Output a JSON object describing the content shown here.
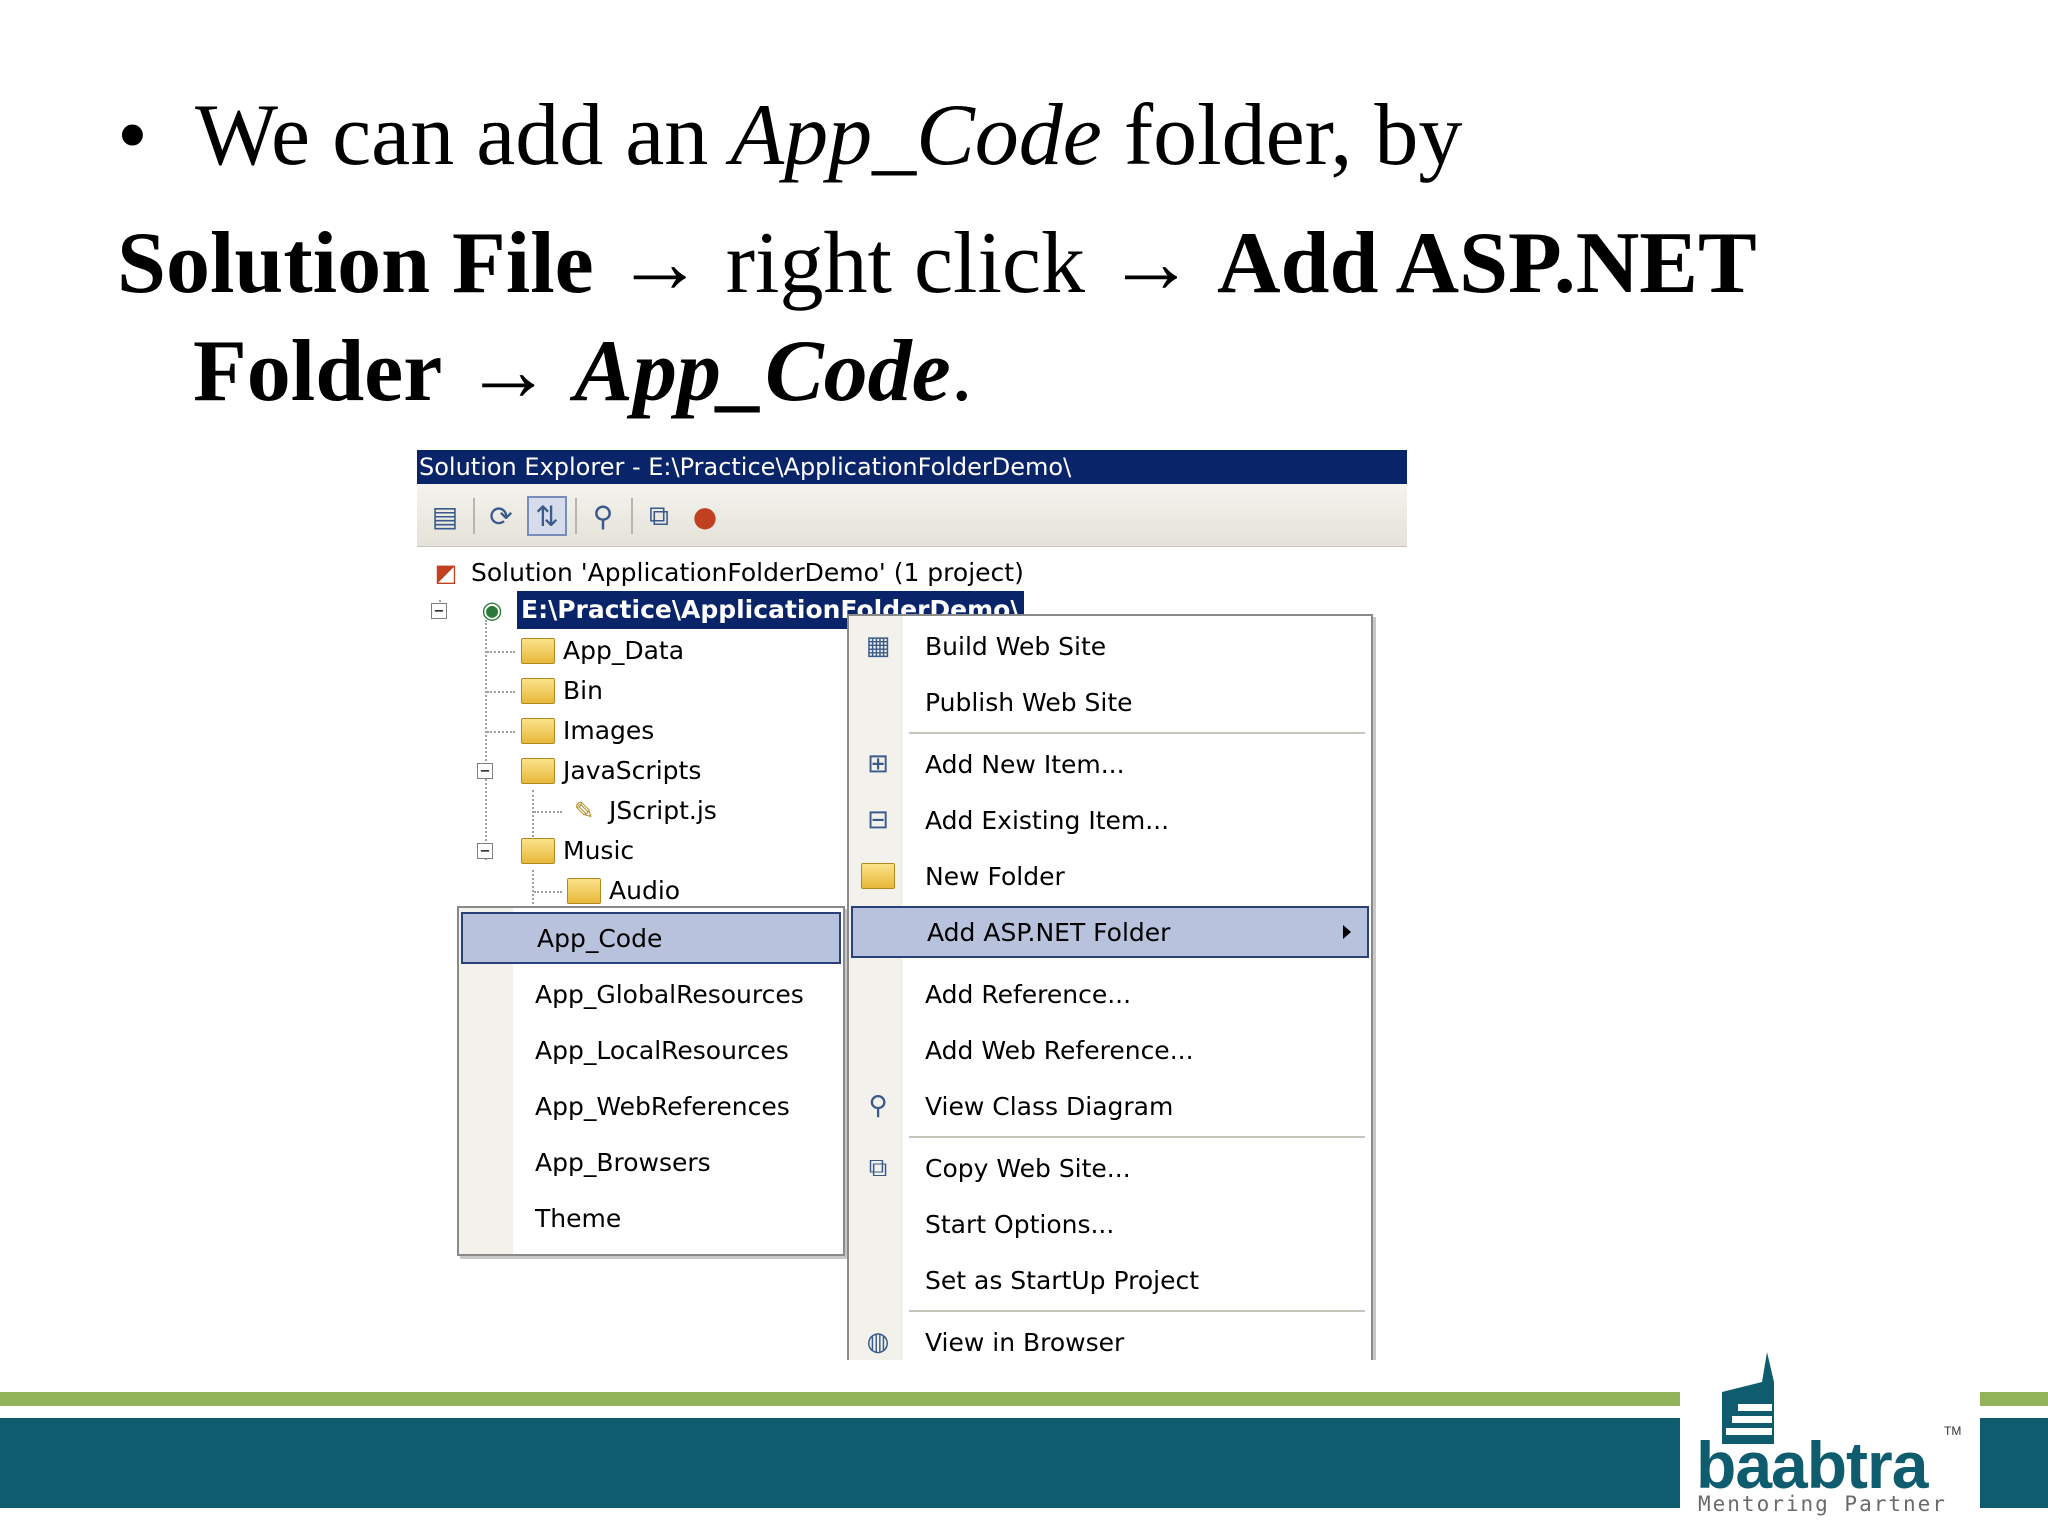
{
  "slide": {
    "line1": {
      "bullet": "•",
      "text_before": "We can add an ",
      "italic": "App_Code",
      "text_after": " folder, by"
    },
    "line2": {
      "bold1": "Solution File",
      "arrow1": " → ",
      "text": "right click",
      "arrow2": " → ",
      "bold2": "Add ASP.NET"
    },
    "line3": {
      "bold1": "Folder",
      "arrow": " → ",
      "bold_italic": "App_Code",
      "period": "."
    }
  },
  "solution_explorer": {
    "title": "Solution Explorer - E:\\Practice\\ApplicationFolderDemo\\",
    "toolbar_icons": [
      "properties-icon",
      "refresh-icon",
      "nest-files-icon",
      "class-diagram-icon",
      "copy-web-site-icon",
      "asp-config-icon"
    ],
    "solution_label": "Solution 'ApplicationFolderDemo' (1 project)",
    "project_label": "E:\\Practice\\ApplicationFolderDemo\\",
    "tree_items": [
      {
        "label": "App_Data"
      },
      {
        "label": "Bin"
      },
      {
        "label": "Images"
      },
      {
        "label": "JavaScripts"
      },
      {
        "label": "JScript.js"
      },
      {
        "label": "Music"
      },
      {
        "label": "Audio"
      }
    ]
  },
  "context_menu": {
    "items": [
      {
        "label": "Build Web Site",
        "icon": "build-icon"
      },
      {
        "label": "Publish Web Site",
        "icon": ""
      },
      {
        "label": "Add New Item...",
        "icon": "add-new-item-icon"
      },
      {
        "label": "Add Existing Item...",
        "icon": "add-existing-item-icon"
      },
      {
        "label": "New Folder",
        "icon": "new-folder-icon"
      },
      {
        "label": "Add ASP.NET Folder",
        "icon": ""
      },
      {
        "label": "Add Reference...",
        "icon": ""
      },
      {
        "label": "Add Web Reference...",
        "icon": ""
      },
      {
        "label": "View Class Diagram",
        "icon": "class-diagram-icon"
      },
      {
        "label": "Copy Web Site...",
        "icon": "copy-web-site-icon"
      },
      {
        "label": "Start Options...",
        "icon": ""
      },
      {
        "label": "Set as StartUp Project",
        "icon": ""
      },
      {
        "label": "View in Browser",
        "icon": "view-in-browser-icon"
      }
    ],
    "selected": "Add ASP.NET Folder"
  },
  "submenu": {
    "items": [
      {
        "label": "App_Code"
      },
      {
        "label": "App_GlobalResources"
      },
      {
        "label": "App_LocalResources"
      },
      {
        "label": "App_WebReferences"
      },
      {
        "label": "App_Browsers"
      },
      {
        "label": "Theme"
      }
    ],
    "selected": "App_Code"
  },
  "logo": {
    "name": "baabtra",
    "tagline": "Mentoring Partner",
    "tm": "TM"
  },
  "colors": {
    "title_bar": "#0a246a",
    "menu_highlight": "#b8c2dc",
    "footer_green": "#92b35a",
    "footer_teal": "#0f5c6e"
  }
}
